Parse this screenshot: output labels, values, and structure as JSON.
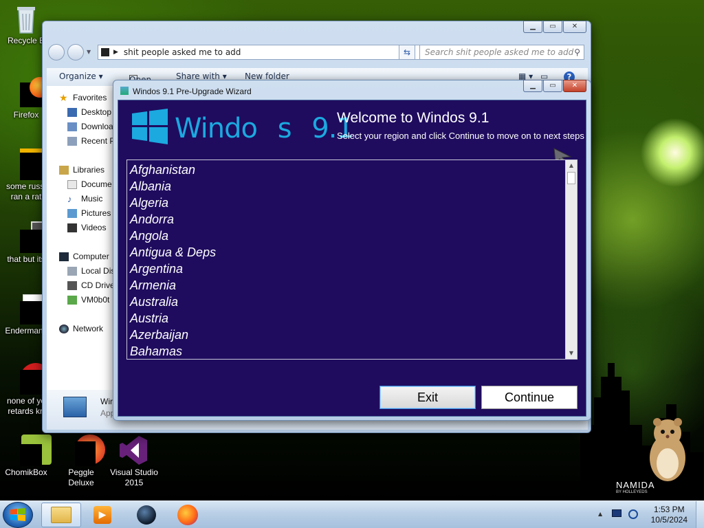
{
  "desktop": {
    "icons": [
      {
        "name": "recycle-bin",
        "label": "Recycle B"
      },
      {
        "name": "firefox",
        "label": "Firefox"
      },
      {
        "name": "some-russian",
        "label": "some russi\nran a rat"
      },
      {
        "name": "that-but-its",
        "label": "that but its"
      },
      {
        "name": "endermanch",
        "label": "Endermanc"
      },
      {
        "name": "none-of-you",
        "label": "none of yo\nretards kn"
      },
      {
        "name": "chomikbox",
        "label": "ChomikBox"
      },
      {
        "name": "peggle-deluxe",
        "label": "Peggle Deluxe"
      },
      {
        "name": "visual-studio",
        "label": "Visual Studio\n2015"
      }
    ],
    "watermark": "NAMIDA",
    "watermark_sub": "BY HOLLEYEDS"
  },
  "explorer": {
    "address": "shit people asked me to add",
    "search_placeholder": "Search shit people asked me to add",
    "toolbar": {
      "organize": "Organize ▾",
      "open": "Open",
      "share_with": "Share with ▾",
      "new_folder": "New folder"
    },
    "nav": {
      "favorites": "Favorites",
      "desktop": "Desktop",
      "downloads": "Downloa",
      "recent": "Recent P",
      "libraries": "Libraries",
      "documents": "Docume",
      "music": "Music",
      "pictures": "Pictures",
      "videos": "Videos",
      "computer": "Computer",
      "local_disk": "Local Dis",
      "cd_drive": "CD Drive",
      "share": "VM0b0t",
      "network": "Network"
    },
    "details": {
      "title": "Wir",
      "subtitle": "App"
    }
  },
  "wizard": {
    "title": "Windos 9.1 Pre-Upgrade Wizard",
    "logo_text": "Windo s 9.1",
    "heading": "Welcome to Windos 9.1",
    "subheading": "Select your region and click Continue to move on to next steps",
    "countries": [
      "Afghanistan",
      "Albania",
      "Algeria",
      "Andorra",
      "Angola",
      "Antigua & Deps",
      "Argentina",
      "Armenia",
      "Australia",
      "Austria",
      "Azerbaijan",
      "Bahamas"
    ],
    "exit_label": "Exit",
    "continue_label": "Continue"
  },
  "taskbar": {
    "time": "1:53 PM",
    "date": "10/5/2024"
  },
  "colors": {
    "wizard_bg": "#1f0c5e",
    "logo_blue": "#1ba9e0",
    "close_red": "#c4432b"
  }
}
